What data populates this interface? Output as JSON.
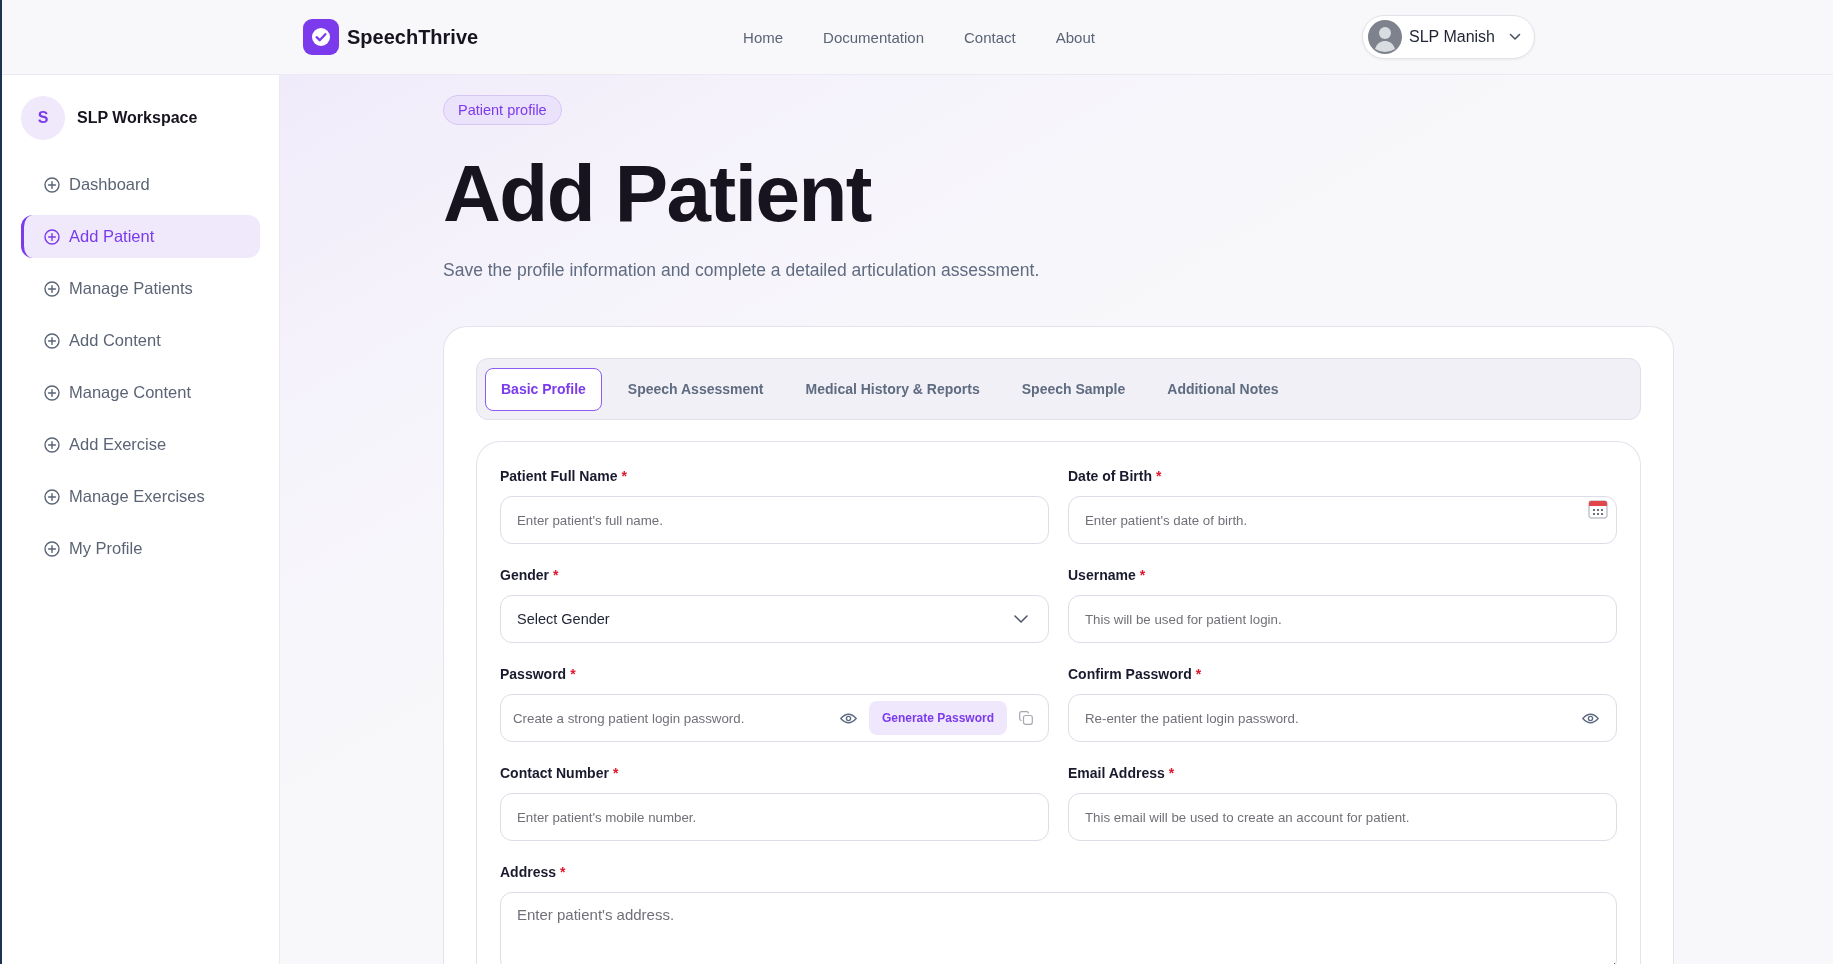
{
  "header": {
    "brand": "SpeechThrive",
    "nav": [
      {
        "label": "Home"
      },
      {
        "label": "Documentation"
      },
      {
        "label": "Contact"
      },
      {
        "label": "About"
      }
    ],
    "user": {
      "name": "SLP Manish"
    }
  },
  "sidebar": {
    "workspace": {
      "initial": "S",
      "name": "SLP Workspace"
    },
    "items": [
      {
        "label": "Dashboard",
        "selected": false
      },
      {
        "label": "Add Patient",
        "selected": true
      },
      {
        "label": "Manage Patients",
        "selected": false
      },
      {
        "label": "Add Content",
        "selected": false
      },
      {
        "label": "Manage Content",
        "selected": false
      },
      {
        "label": "Add Exercise",
        "selected": false
      },
      {
        "label": "Manage Exercises",
        "selected": false
      },
      {
        "label": "My Profile",
        "selected": false
      }
    ]
  },
  "page": {
    "badge": "Patient profile",
    "title": "Add Patient",
    "subtitle": "Save the profile information and complete a detailed articulation assessment."
  },
  "tabs": [
    {
      "label": "Basic Profile",
      "selected": true
    },
    {
      "label": "Speech Assessment",
      "selected": false
    },
    {
      "label": "Medical History & Reports",
      "selected": false
    },
    {
      "label": "Speech Sample",
      "selected": false
    },
    {
      "label": "Additional Notes",
      "selected": false
    }
  ],
  "form": {
    "fields": [
      {
        "kind": "text",
        "label": "Patient Full Name",
        "required_mark": "*",
        "placeholder": "Enter patient's full name."
      },
      {
        "kind": "date",
        "label": "Date of Birth",
        "required_mark": "*",
        "placeholder": "Enter patient's date of birth."
      },
      {
        "kind": "select",
        "label": "Gender",
        "required_mark": "*",
        "value": "Select Gender"
      },
      {
        "kind": "text",
        "label": "Username",
        "required_mark": "*",
        "placeholder": "This will be used for patient login."
      },
      {
        "kind": "password_generator",
        "label": "Password",
        "required_mark": "*",
        "placeholder": "Create a strong patient login password.",
        "button": "Generate Password"
      },
      {
        "kind": "password",
        "label": "Confirm Password",
        "required_mark": "*",
        "placeholder": "Re-enter the patient login password."
      },
      {
        "kind": "text",
        "label": "Contact Number",
        "required_mark": "*",
        "placeholder": "Enter patient's mobile number."
      },
      {
        "kind": "text",
        "label": "Email Address",
        "required_mark": "*",
        "placeholder": "This email will be used to create an account for patient."
      },
      {
        "kind": "textarea",
        "label": "Address",
        "required_mark": "*",
        "placeholder": "Enter patient's address."
      }
    ]
  }
}
